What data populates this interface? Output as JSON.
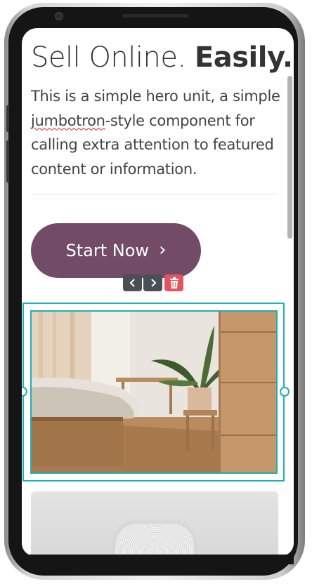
{
  "hero": {
    "title_light": "Sell Online. ",
    "title_bold": "Easily.",
    "paragraph_before": "This is a simple hero unit, a simple ",
    "paragraph_flagged_word": "jumbotron",
    "paragraph_after": "-style component for calling extra attention to featured content or information.",
    "cta_label": "Start Now",
    "cta_icon": "chevron-right-icon"
  },
  "toolbar": {
    "move_left_icon": "chevron-left-icon",
    "move_right_icon": "chevron-right-icon",
    "delete_icon": "trash-icon"
  },
  "colors": {
    "cta_background": "#724b66",
    "selection_outline": "#22aeba",
    "delete_button": "#e05561",
    "toolbar_button": "#4a4f55"
  }
}
